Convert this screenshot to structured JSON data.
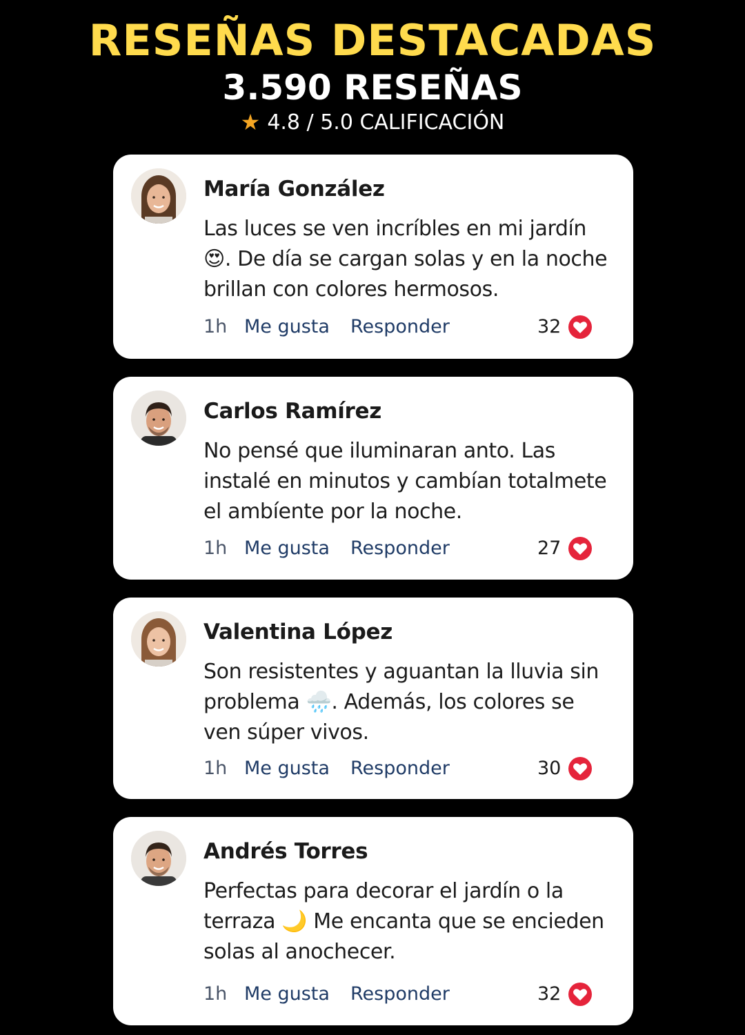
{
  "header": {
    "title": "RESEÑAS DESTACADAS",
    "count": "3.590 RESEÑAS",
    "rating_text": "4.8 / 5.0 CALIFICACIÓN",
    "rating_value": 4.8,
    "rating_max": 5.0
  },
  "action_labels": {
    "time": "1h",
    "like": "Me gusta",
    "reply": "Responder"
  },
  "reviews": [
    {
      "name": "María González",
      "text": "Las luces se ven incríbles en mi jardín 😍. De día se cargan solas y en la noche brillan con colores hermosos.",
      "likes": "32",
      "avatar": "woman-avatar"
    },
    {
      "name": "Carlos Ramírez",
      "text": "No pensé que iluminaran anto. Las instalé en minutos y cambían totalmete el ambíente por la noche.",
      "likes": "27",
      "avatar": "man-avatar"
    },
    {
      "name": "Valentina López",
      "text": "Son resistentes y aguantan la lluvia sin problema 🌧️. Además, los colores se ven súper vivos.",
      "likes": "30",
      "avatar": "woman-avatar"
    },
    {
      "name": "Andrés Torres",
      "text": "Perfectas para decorar el jardín o la terraza 🌙  Me encanta que se encieden solas al anochecer.",
      "likes": "32",
      "avatar": "man-avatar"
    }
  ],
  "colors": {
    "background": "#000000",
    "title": "#FFDB4D",
    "star": "#F5A623",
    "heart": "#E5243B",
    "link": "#1F3B66"
  }
}
